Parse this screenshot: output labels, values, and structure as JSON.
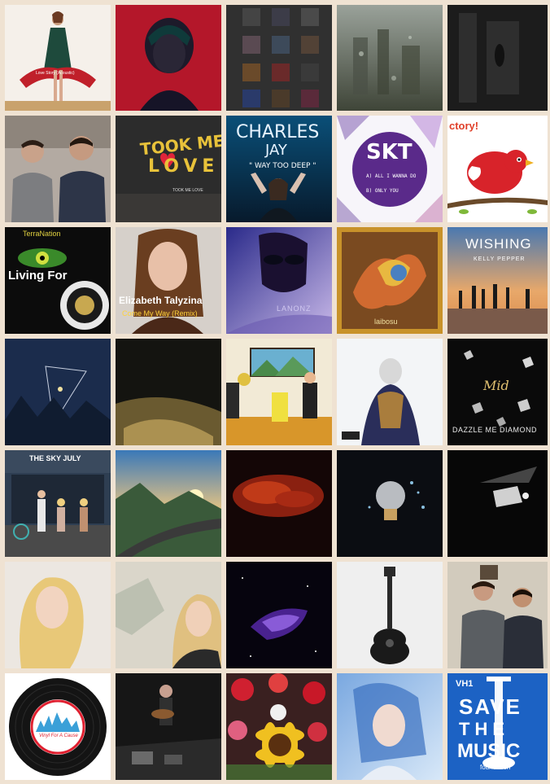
{
  "grid": {
    "rows": [
      [
        {
          "name": "album-woman-ribbon",
          "text": [
            "Love Story (Acoustic)"
          ]
        },
        {
          "name": "album-red-portrait",
          "text": []
        },
        {
          "name": "album-collage-artists",
          "text": []
        },
        {
          "name": "album-rainy-window",
          "text": []
        },
        {
          "name": "album-dark-room",
          "text": []
        }
      ],
      [
        {
          "name": "album-two-men",
          "text": []
        },
        {
          "name": "album-took-me-love",
          "text": [
            "TOOK ME",
            "LOVE",
            "TOOK ME LOVE"
          ]
        },
        {
          "name": "album-charles-jay",
          "text": [
            "CHARLES",
            "JAY",
            "\" WAY TOO DEEP \""
          ]
        },
        {
          "name": "album-skt",
          "text": [
            "SKT",
            "A) ALL I WANNA DO",
            "B) ONLY YOU"
          ]
        },
        {
          "name": "album-red-bird",
          "text": [
            "ctory!"
          ]
        }
      ],
      [
        {
          "name": "album-living-for",
          "text": [
            "TerraNation",
            "Living For"
          ]
        },
        {
          "name": "album-elizabeth-talyzina",
          "text": [
            "Elizabeth Talyzina",
            "Come My Way (Remix)"
          ]
        },
        {
          "name": "album-lanonz",
          "text": [
            "LANONZ"
          ]
        },
        {
          "name": "album-love-song-shadow",
          "text": [
            "laibosu"
          ]
        },
        {
          "name": "album-wishing",
          "text": [
            "WISHING",
            "KELLY PEPPER"
          ]
        }
      ],
      [
        {
          "name": "album-triangle-forest",
          "text": []
        },
        {
          "name": "album-golden-grass",
          "text": []
        },
        {
          "name": "album-cartoon-room",
          "text": []
        },
        {
          "name": "album-silhouette-figure",
          "text": []
        },
        {
          "name": "album-dazzle-me-diamond",
          "text": [
            "Mid",
            "DAZZLE ME DIAMOND"
          ]
        }
      ],
      [
        {
          "name": "album-four-people",
          "text": [
            "THE SKY JULY"
          ]
        },
        {
          "name": "album-mountain-road",
          "text": []
        },
        {
          "name": "album-red-clouds",
          "text": []
        },
        {
          "name": "album-lightbulb",
          "text": []
        },
        {
          "name": "album-piano-stage",
          "text": []
        }
      ],
      [
        {
          "name": "album-blonde-woman",
          "text": []
        },
        {
          "name": "album-woman-leaves",
          "text": []
        },
        {
          "name": "album-purple-space",
          "text": []
        },
        {
          "name": "album-guitar",
          "text": []
        },
        {
          "name": "album-two-men-sitting",
          "text": []
        }
      ],
      [
        {
          "name": "album-vinyl-for-a-cause",
          "text": [
            "Vinyl For A Cause"
          ]
        },
        {
          "name": "album-concert-guitarist",
          "text": []
        },
        {
          "name": "album-flowers-sunflower",
          "text": []
        },
        {
          "name": "album-blue-portrait",
          "text": []
        },
        {
          "name": "album-vh1-save-the-music",
          "text": [
            "VH1",
            "SAVE",
            "THE",
            "MUSIC",
            "foundation"
          ]
        }
      ]
    ]
  }
}
